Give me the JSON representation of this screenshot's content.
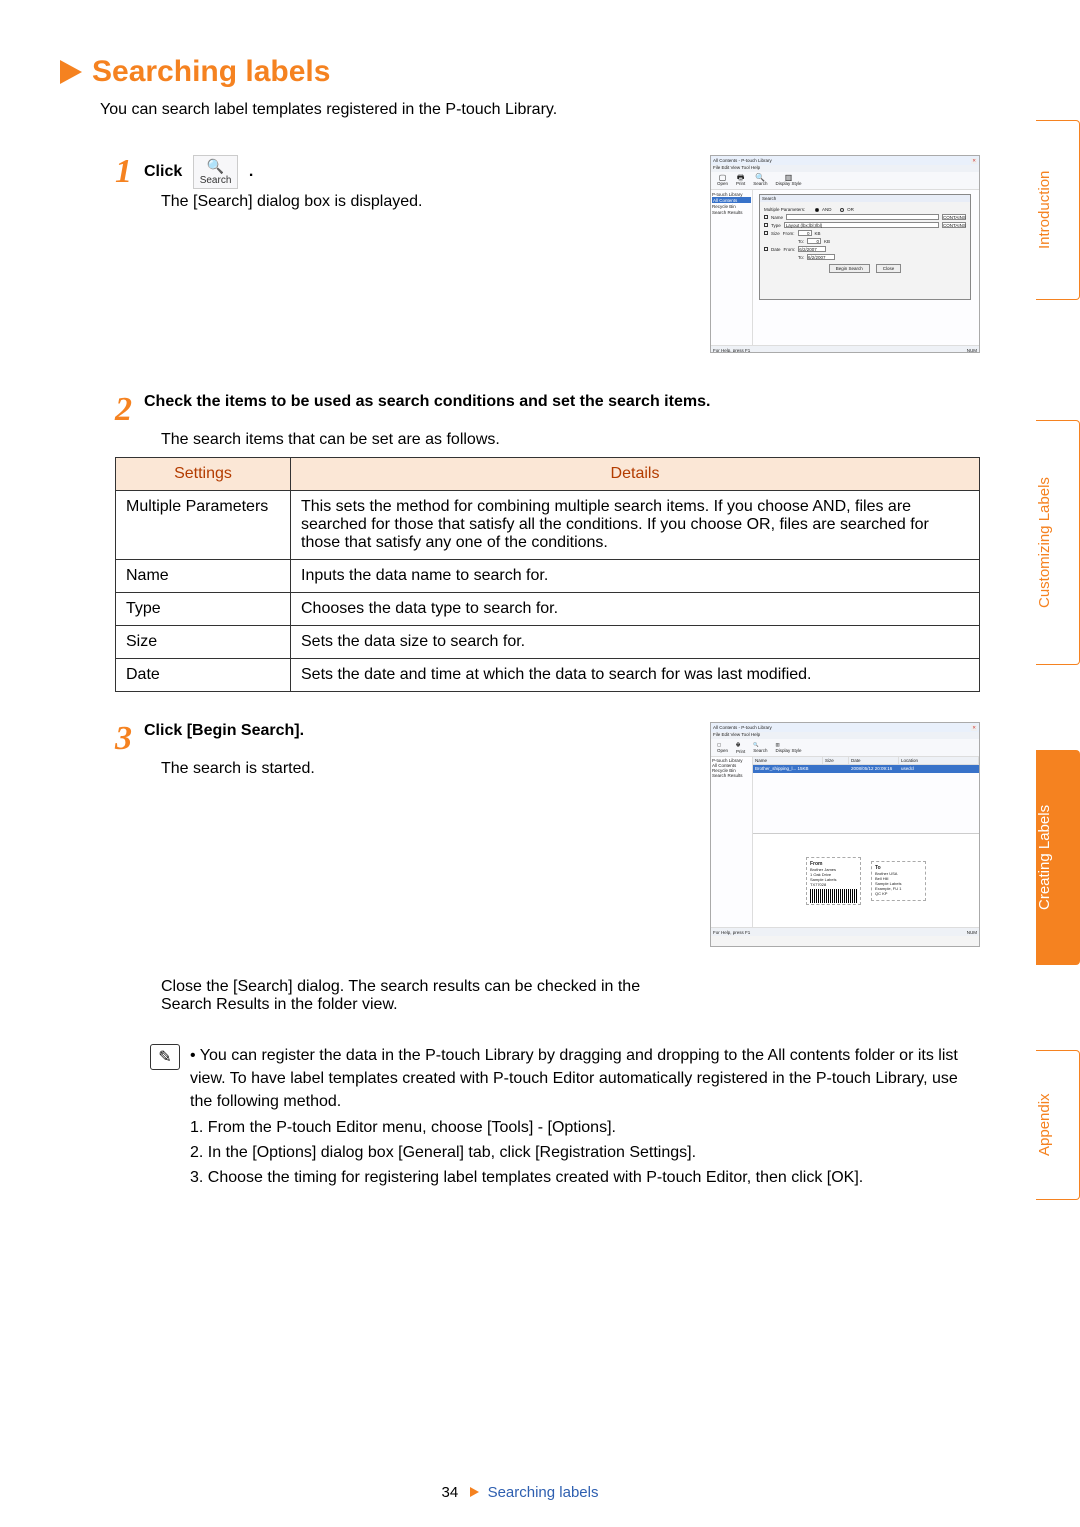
{
  "title": "Searching labels",
  "intro": "You can search label templates registered in the P-touch Library.",
  "step1": {
    "click": "Click",
    "icon_label": "Search",
    "period": ".",
    "body": "The [Search] dialog box is displayed."
  },
  "step2": {
    "bold": "Check the items to be used as search conditions and set the search items.",
    "body": "The search items that can be set are as follows.",
    "table": {
      "h1": "Settings",
      "h2": "Details",
      "rows": [
        [
          "Multiple Parameters",
          "This sets the method for combining multiple search items. If you choose AND, files are searched for those that satisfy all the conditions. If you choose OR, files are searched for those that satisfy any one of the conditions."
        ],
        [
          "Name",
          "Inputs the data name to search for."
        ],
        [
          "Type",
          "Chooses the data type to search for."
        ],
        [
          "Size",
          "Sets the data size to search for."
        ],
        [
          "Date",
          "Sets the date and time at which the data to search for was last modified."
        ]
      ]
    }
  },
  "step3": {
    "bold": "Click [Begin Search].",
    "body": "The search is started.",
    "close_text": "Close the [Search] dialog. The search results can be checked in the Search Results in the folder view."
  },
  "note": {
    "bullet": "• You can register the data in the P-touch Library by dragging and dropping to the All contents folder or its list view. To have label templates created with P-touch Editor automatically registered in the P-touch Library, use the following method.",
    "li1": "1. From the P-touch Editor menu, choose [Tools] - [Options].",
    "li2": "2. In the [Options] dialog box [General] tab, click [Registration Settings].",
    "li3": "3. Choose the timing for registering label templates created with P-touch Editor, then click [OK]."
  },
  "screenshot1": {
    "title": "All Contents - P-touch Library",
    "menu": "File  Edit  View  Tool  Help",
    "toolbar": [
      "Open",
      "Print",
      "Search",
      "Display Style"
    ],
    "tree": {
      "root": "P-touch Library",
      "sel": "All Contents",
      "item2": "Recycle Bin",
      "item3": "Search Results"
    },
    "dialog": {
      "title": "Search",
      "mp": "Multiple Parameters:",
      "and": "AND",
      "or": "OR",
      "name": "Name",
      "type": "Type",
      "size": "Size",
      "date": "Date",
      "type_val": "Layout (lbx;lbl;rlbl)",
      "contains": "CONTAINS",
      "from": "From:",
      "to": "To:",
      "from_val": "0",
      "kb": "KB",
      "date_from": "6/2/2007",
      "date_to": "6/2/2007",
      "begin": "Begin Search",
      "close": "Close"
    },
    "status": "For Help, press F1",
    "num": "NUM"
  },
  "screenshot2": {
    "title": "All Contents - P-touch Library",
    "menu": "File  Edit  View  Tool  Help",
    "toolbar": [
      "Open",
      "Print",
      "Search",
      "Display Style"
    ],
    "tree": {
      "root": "P-touch Library",
      "sel": "All Contents",
      "item2": "Recycle Bin",
      "item3": "Search Results"
    },
    "list_header": [
      "Name",
      "Size",
      "Date",
      "Location"
    ],
    "list_row": [
      "Brother_shipping_l...  15KB",
      "2008/05/12 20:09:16",
      "",
      "usedcl"
    ],
    "preview": {
      "from_title": "From",
      "from_body": "Brother James\n1 Oak Drive\nSample Labels\nTX77028",
      "to_title": "To",
      "to_body": "Brother USA\nBell Hill\nSample Labels\nExample, FU 1\nQC KP"
    },
    "status": "For Help, press F1",
    "num": "NUM"
  },
  "footer": {
    "page": "34",
    "text": "Searching labels"
  },
  "tabs": {
    "t1": "Introduction",
    "t2": "Customizing Labels",
    "t3": "Creating Labels",
    "t4": "Appendix"
  }
}
